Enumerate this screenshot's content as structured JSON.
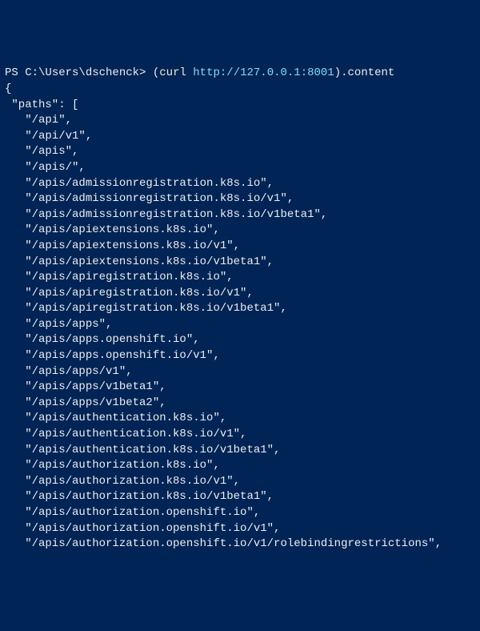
{
  "prompt": {
    "ps_prefix": "PS ",
    "cwd": "C:\\Users\\dschenck",
    "arrow": "> ",
    "paren_open": "(",
    "cmdlet": "curl",
    "space": " ",
    "url": "http://127.0.0.1:8001",
    "paren_close": ")",
    "property": ".content"
  },
  "json_output": {
    "open_brace": "{",
    "paths_key": " \"paths\": [",
    "paths": [
      "/api",
      "/api/v1",
      "/apis",
      "/apis/",
      "/apis/admissionregistration.k8s.io",
      "/apis/admissionregistration.k8s.io/v1",
      "/apis/admissionregistration.k8s.io/v1beta1",
      "/apis/apiextensions.k8s.io",
      "/apis/apiextensions.k8s.io/v1",
      "/apis/apiextensions.k8s.io/v1beta1",
      "/apis/apiregistration.k8s.io",
      "/apis/apiregistration.k8s.io/v1",
      "/apis/apiregistration.k8s.io/v1beta1",
      "/apis/apps",
      "/apis/apps.openshift.io",
      "/apis/apps.openshift.io/v1",
      "/apis/apps/v1",
      "/apis/apps/v1beta1",
      "/apis/apps/v1beta2",
      "/apis/authentication.k8s.io",
      "/apis/authentication.k8s.io/v1",
      "/apis/authentication.k8s.io/v1beta1",
      "/apis/authorization.k8s.io",
      "/apis/authorization.k8s.io/v1",
      "/apis/authorization.k8s.io/v1beta1",
      "/apis/authorization.openshift.io",
      "/apis/authorization.openshift.io/v1",
      "/apis/authorization.openshift.io/v1/rolebindingrestrictions"
    ]
  }
}
